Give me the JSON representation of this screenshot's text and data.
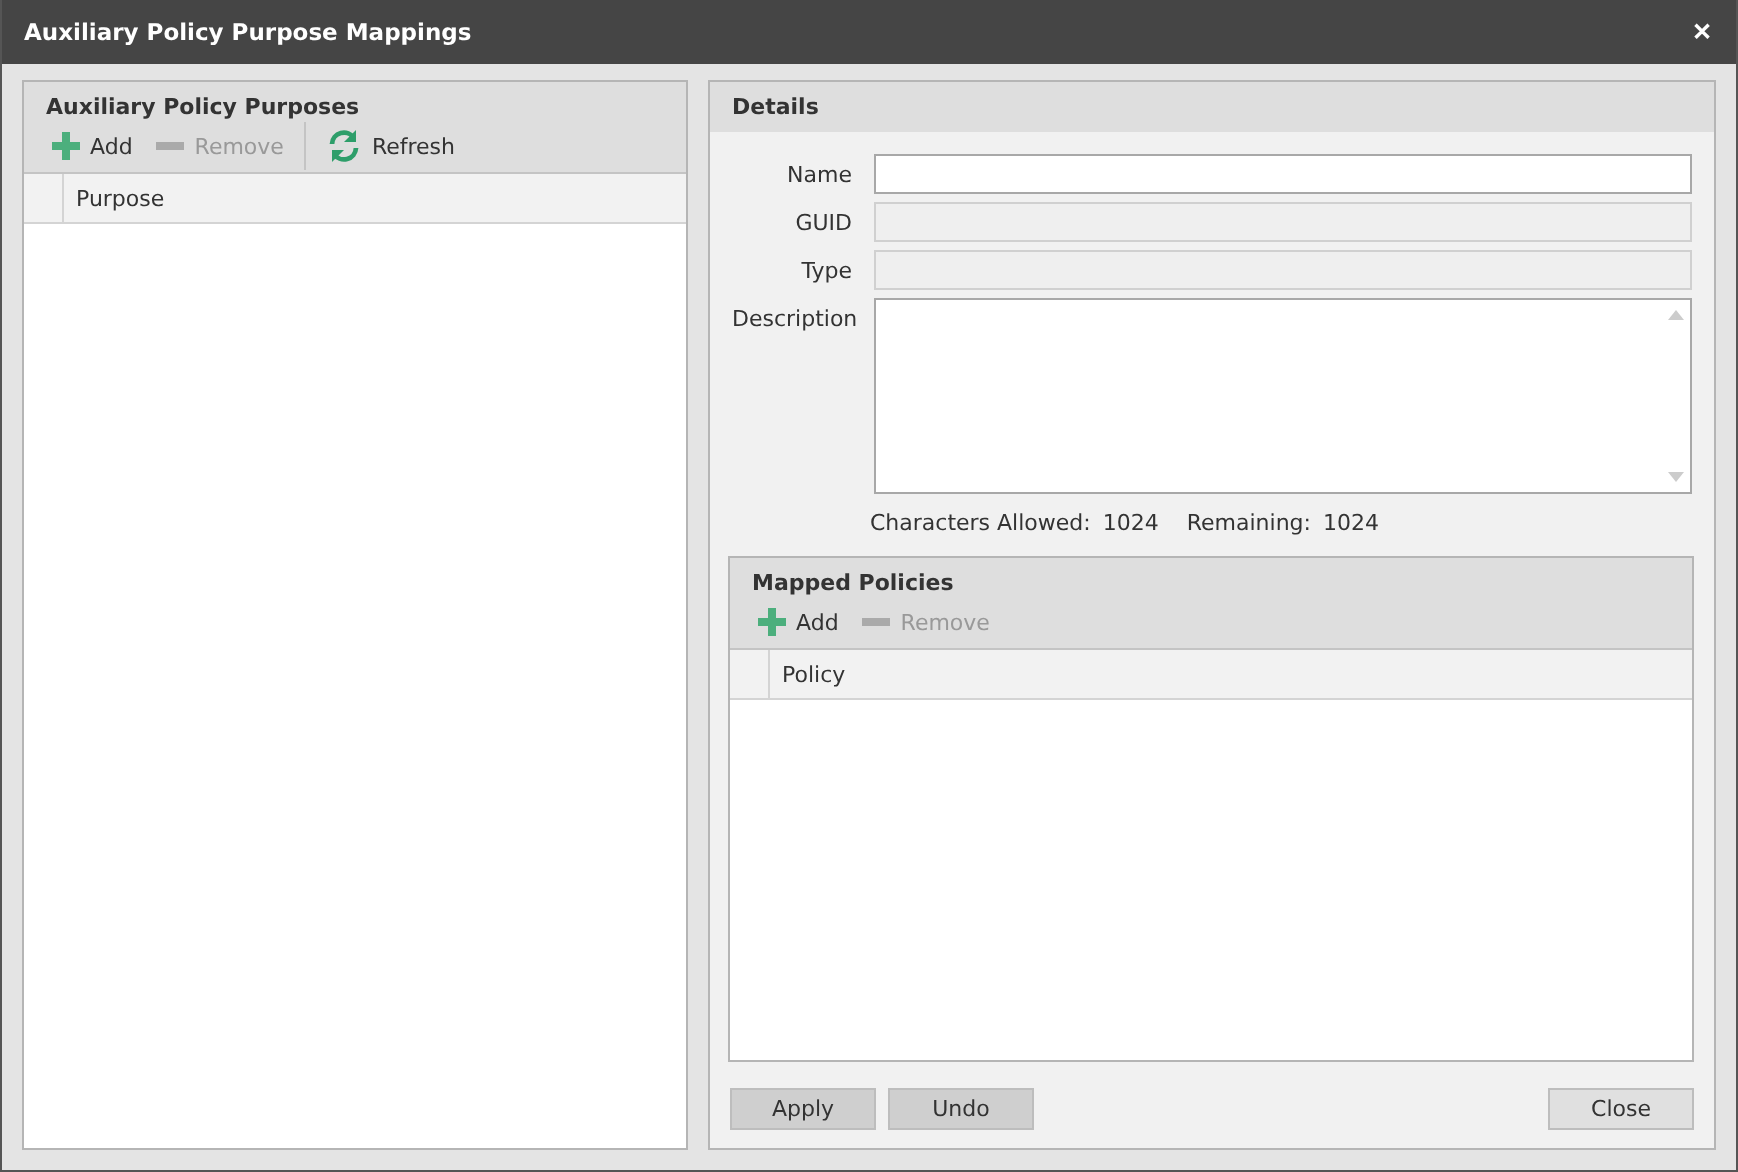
{
  "window": {
    "title": "Auxiliary Policy Purpose Mappings",
    "close": "✕"
  },
  "purposes_panel": {
    "title": "Auxiliary Policy Purposes",
    "toolbar": [
      {
        "kind": "add",
        "label": "Add",
        "disabled": false
      },
      {
        "kind": "remove",
        "label": "Remove",
        "disabled": true
      },
      {
        "kind": "refresh",
        "label": "Refresh",
        "disabled": false
      }
    ],
    "columns": [
      "Purpose"
    ]
  },
  "details": {
    "title": "Details",
    "fields": [
      {
        "kind": "text",
        "label": "Name",
        "disabled": false
      },
      {
        "kind": "text",
        "label": "GUID",
        "disabled": true
      },
      {
        "kind": "text",
        "label": "Type",
        "disabled": true
      },
      {
        "kind": "textarea",
        "label": "Description",
        "disabled": false
      }
    ],
    "counter": [
      {
        "label": "Characters Allowed:",
        "value": "1024"
      },
      {
        "label": "Remaining:",
        "value": "1024"
      }
    ],
    "mapped_policies": {
      "title": "Mapped Policies",
      "toolbar": [
        {
          "kind": "add",
          "label": "Add",
          "disabled": false
        },
        {
          "kind": "remove",
          "label": "Remove",
          "disabled": true
        }
      ],
      "columns": [
        "Policy"
      ]
    },
    "buttons": [
      {
        "label": "Apply",
        "disabled": true
      },
      {
        "label": "Undo",
        "disabled": true
      },
      {
        "label": "Close",
        "disabled": false
      }
    ]
  }
}
